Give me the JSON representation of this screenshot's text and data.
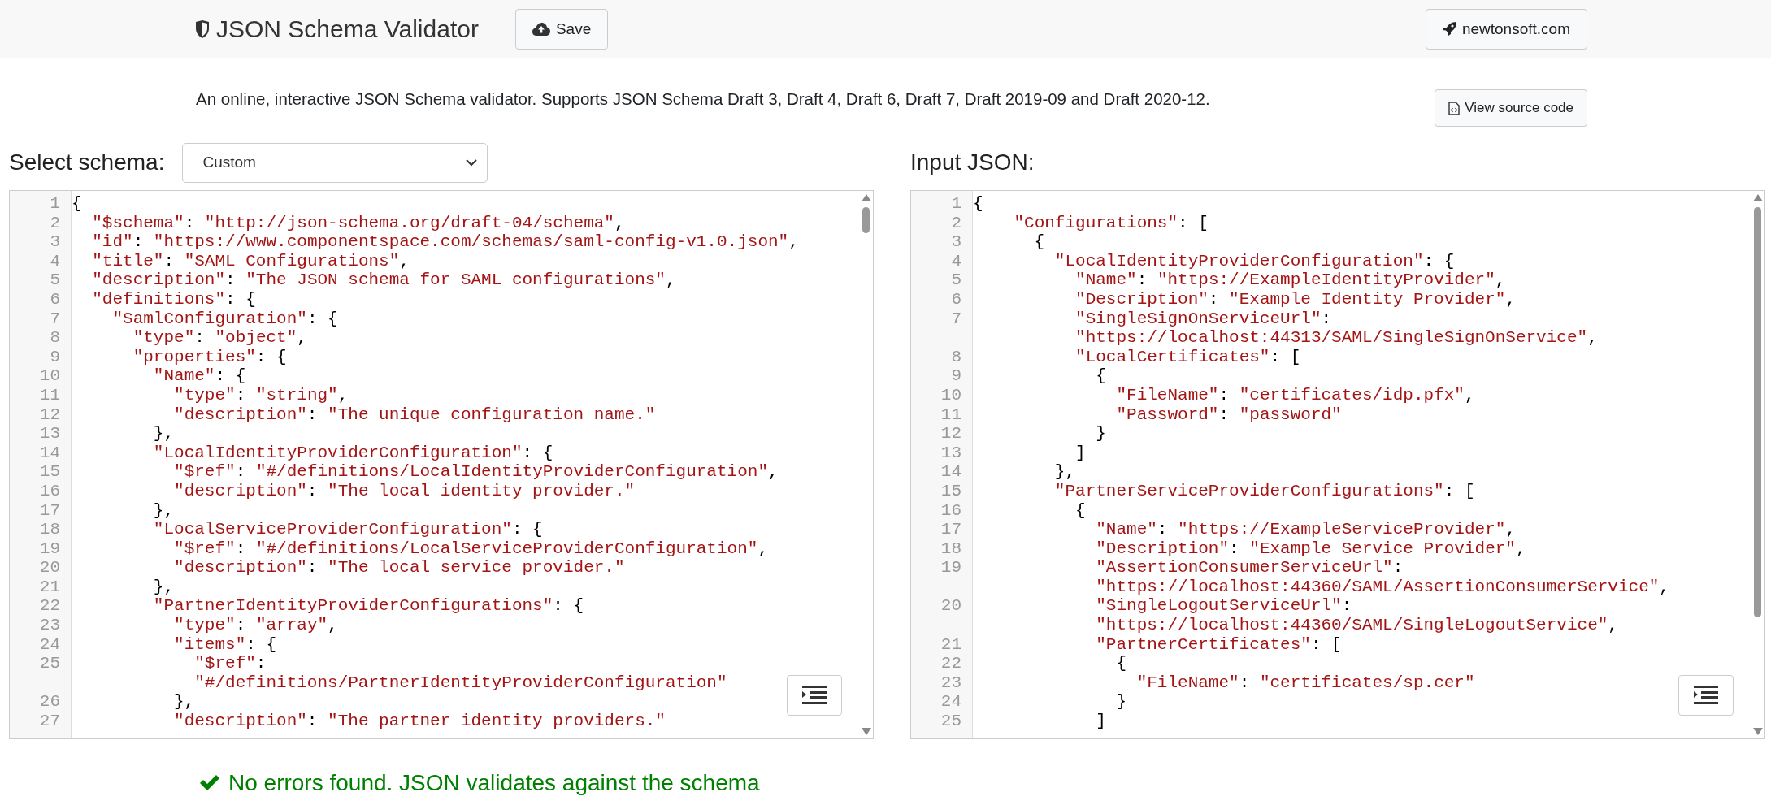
{
  "header": {
    "title": "JSON Schema Validator",
    "save_button": "Save",
    "site_button": "newtonsoft.com"
  },
  "intro": {
    "text": "An online, interactive JSON Schema validator. Supports JSON Schema Draft 3, Draft 4, Draft 6, Draft 7, Draft 2019-09 and Draft 2020-12.",
    "source_button": "View source code"
  },
  "schema_panel": {
    "label": "Select schema:",
    "select_value": "Custom",
    "editor": {
      "lines": [
        {
          "num": "1",
          "code": "{"
        },
        {
          "num": "2",
          "code": "  \"$schema\": \"http://json-schema.org/draft-04/schema\","
        },
        {
          "num": "3",
          "code": "  \"id\": \"https://www.componentspace.com/schemas/saml-config-v1.0.json\","
        },
        {
          "num": "4",
          "code": "  \"title\": \"SAML Configurations\","
        },
        {
          "num": "5",
          "code": "  \"description\": \"The JSON schema for SAML configurations\","
        },
        {
          "num": "6",
          "code": "  \"definitions\": {"
        },
        {
          "num": "7",
          "code": "    \"SamlConfiguration\": {"
        },
        {
          "num": "8",
          "code": "      \"type\": \"object\","
        },
        {
          "num": "9",
          "code": "      \"properties\": {"
        },
        {
          "num": "10",
          "code": "        \"Name\": {"
        },
        {
          "num": "11",
          "code": "          \"type\": \"string\","
        },
        {
          "num": "12",
          "code": "          \"description\": \"The unique configuration name.\""
        },
        {
          "num": "13",
          "code": "        },"
        },
        {
          "num": "14",
          "code": "        \"LocalIdentityProviderConfiguration\": {"
        },
        {
          "num": "15",
          "code": "          \"$ref\": \"#/definitions/LocalIdentityProviderConfiguration\","
        },
        {
          "num": "16",
          "code": "          \"description\": \"The local identity provider.\""
        },
        {
          "num": "17",
          "code": "        },"
        },
        {
          "num": "18",
          "code": "        \"LocalServiceProviderConfiguration\": {"
        },
        {
          "num": "19",
          "code": "          \"$ref\": \"#/definitions/LocalServiceProviderConfiguration\","
        },
        {
          "num": "20",
          "code": "          \"description\": \"The local service provider.\""
        },
        {
          "num": "21",
          "code": "        },"
        },
        {
          "num": "22",
          "code": "        \"PartnerIdentityProviderConfigurations\": {"
        },
        {
          "num": "23",
          "code": "          \"type\": \"array\","
        },
        {
          "num": "24",
          "code": "          \"items\": {"
        },
        {
          "num": "25",
          "code": "            \"$ref\":",
          "cont": "            \"#/definitions/PartnerIdentityProviderConfiguration\""
        },
        {
          "num": "26",
          "code": "          },"
        },
        {
          "num": "27",
          "code": "          \"description\": \"The partner identity providers.\""
        }
      ]
    }
  },
  "input_panel": {
    "label": "Input JSON:",
    "editor": {
      "lines": [
        {
          "num": "1",
          "code": "{"
        },
        {
          "num": "2",
          "code": "    \"Configurations\": ["
        },
        {
          "num": "3",
          "code": "      {"
        },
        {
          "num": "4",
          "code": "        \"LocalIdentityProviderConfiguration\": {"
        },
        {
          "num": "5",
          "code": "          \"Name\": \"https://ExampleIdentityProvider\","
        },
        {
          "num": "6",
          "code": "          \"Description\": \"Example Identity Provider\","
        },
        {
          "num": "7",
          "code": "          \"SingleSignOnServiceUrl\":",
          "cont": "          \"https://localhost:44313/SAML/SingleSignOnService\","
        },
        {
          "num": "8",
          "code": "          \"LocalCertificates\": ["
        },
        {
          "num": "9",
          "code": "            {"
        },
        {
          "num": "10",
          "code": "              \"FileName\": \"certificates/idp.pfx\","
        },
        {
          "num": "11",
          "code": "              \"Password\": \"password\""
        },
        {
          "num": "12",
          "code": "            }"
        },
        {
          "num": "13",
          "code": "          ]"
        },
        {
          "num": "14",
          "code": "        },"
        },
        {
          "num": "15",
          "code": "        \"PartnerServiceProviderConfigurations\": ["
        },
        {
          "num": "16",
          "code": "          {"
        },
        {
          "num": "17",
          "code": "            \"Name\": \"https://ExampleServiceProvider\","
        },
        {
          "num": "18",
          "code": "            \"Description\": \"Example Service Provider\","
        },
        {
          "num": "19",
          "code": "            \"AssertionConsumerServiceUrl\":",
          "cont": "            \"https://localhost:44360/SAML/AssertionConsumerService\","
        },
        {
          "num": "20",
          "code": "            \"SingleLogoutServiceUrl\":",
          "cont": "            \"https://localhost:44360/SAML/SingleLogoutService\","
        },
        {
          "num": "21",
          "code": "            \"PartnerCertificates\": ["
        },
        {
          "num": "22",
          "code": "              {"
        },
        {
          "num": "23",
          "code": "                \"FileName\": \"certificates/sp.cer\""
        },
        {
          "num": "24",
          "code": "              }"
        },
        {
          "num": "25",
          "code": "            ]"
        }
      ]
    }
  },
  "status": {
    "message": "No errors found. JSON validates against the schema"
  }
}
